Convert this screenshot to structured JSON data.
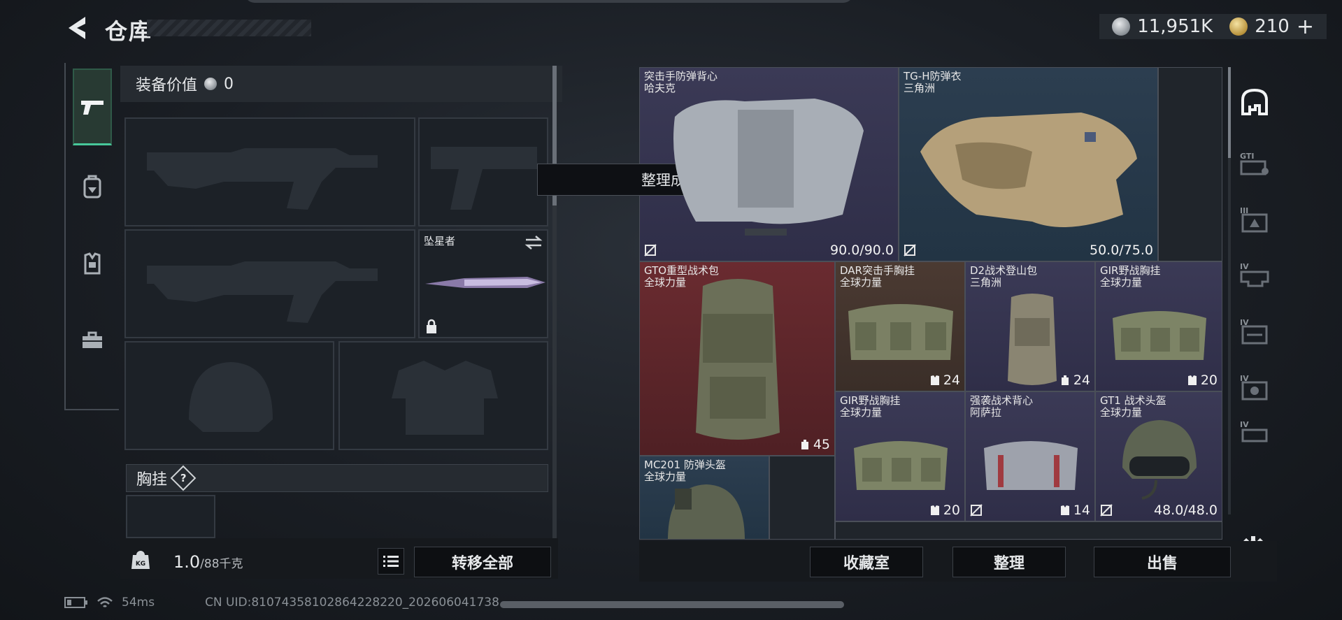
{
  "header": {
    "title": "仓库"
  },
  "currency": {
    "silver": "11,951K",
    "gold": "210",
    "gold_add": "+"
  },
  "left_tabs": [
    {
      "name": "pistol-icon",
      "active": true
    },
    {
      "name": "backpack-icon",
      "active": false
    },
    {
      "name": "vest-icon",
      "active": false
    },
    {
      "name": "toolbox-icon",
      "active": false
    }
  ],
  "equipment": {
    "value_label": "装备价值",
    "value": "0",
    "melee_name": "坠星者",
    "chest_label": "胸挂",
    "help": "?"
  },
  "weight": {
    "current": "1.0",
    "max": "/88千克"
  },
  "buttons": {
    "transfer_all": "转移全部",
    "collection": "收藏室",
    "organize": "整理",
    "sell": "出售"
  },
  "toast": "整理成功",
  "items": [
    {
      "name": "突击手防弹背心",
      "source": "哈夫克",
      "stat": "90.0/90.0"
    },
    {
      "name": "TG-H防弹衣",
      "source": "三角洲",
      "stat": "50.0/75.0"
    },
    {
      "name": "GTO重型战术包",
      "source": "全球力量",
      "stat": "45"
    },
    {
      "name": "DAR突击手胸挂",
      "source": "全球力量",
      "stat": "24"
    },
    {
      "name": "D2战术登山包",
      "source": "三角洲",
      "stat": "24"
    },
    {
      "name": "GIR野战胸挂",
      "source": "全球力量",
      "stat": "20"
    },
    {
      "name": "GIR野战胸挂",
      "source": "全球力量",
      "stat": "20"
    },
    {
      "name": "强袭战术背心",
      "source": "阿萨拉",
      "stat": "14"
    },
    {
      "name": "GT1 战术头盔",
      "source": "全球力量",
      "stat": "48.0/48.0"
    },
    {
      "name": "MC201 防弹头盔",
      "source": "全球力量",
      "stat": ""
    }
  ],
  "right_tabs": [
    "home-icon",
    "GTI",
    "III",
    "IV",
    "IV",
    "IV",
    "IV"
  ],
  "status": {
    "ping": "54ms",
    "uid": "CN UID:8107435810286422822​0_202606041738"
  }
}
